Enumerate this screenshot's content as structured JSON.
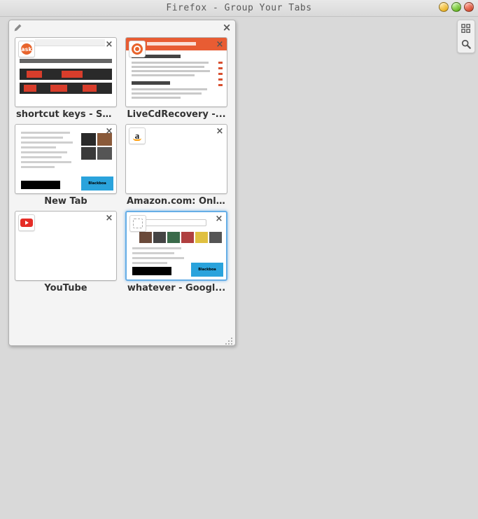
{
  "window": {
    "title": "Firefox - Group Your Tabs"
  },
  "tabGroup": {
    "tabs": [
      {
        "label": "shortcut keys - Sc...",
        "favicon": "ask",
        "active": false,
        "preview": "ask"
      },
      {
        "label": "LiveCdRecovery -...",
        "favicon": "ubuntu",
        "active": false,
        "preview": "ubuntu"
      },
      {
        "label": "New Tab",
        "favicon": "none",
        "active": false,
        "preview": "newtab"
      },
      {
        "label": "Amazon.com: Onl...",
        "favicon": "amazon",
        "active": false,
        "preview": "blank"
      },
      {
        "label": "YouTube",
        "favicon": "youtube",
        "active": false,
        "preview": "blank"
      },
      {
        "label": "whatever - Googl...",
        "favicon": "blank",
        "active": true,
        "preview": "google"
      }
    ]
  },
  "previewText": {
    "blackboard": "Blackboa"
  }
}
